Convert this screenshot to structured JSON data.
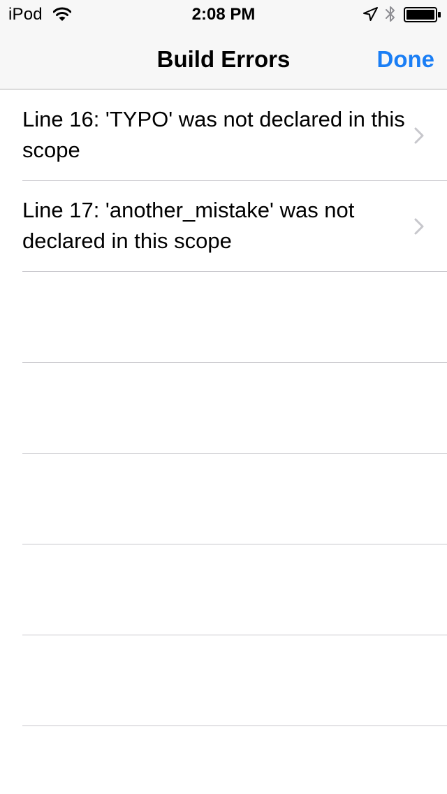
{
  "status_bar": {
    "carrier": "iPod",
    "time": "2:08 PM",
    "icons": [
      "wifi-icon",
      "location-arrow-icon",
      "bluetooth-icon",
      "battery-icon"
    ]
  },
  "nav_bar": {
    "title": "Build Errors",
    "done_label": "Done"
  },
  "errors": [
    {
      "text": "Line 16: 'TYPO' was not declared in this scope"
    },
    {
      "text": "Line 17: 'another_mistake' was not declared in this scope"
    }
  ],
  "empty_rows": 5,
  "colors": {
    "accent": "#1a7ef5",
    "chevron": "#c7c7cc",
    "separator": "#c8c7cc",
    "bar_background": "#f7f7f7"
  }
}
